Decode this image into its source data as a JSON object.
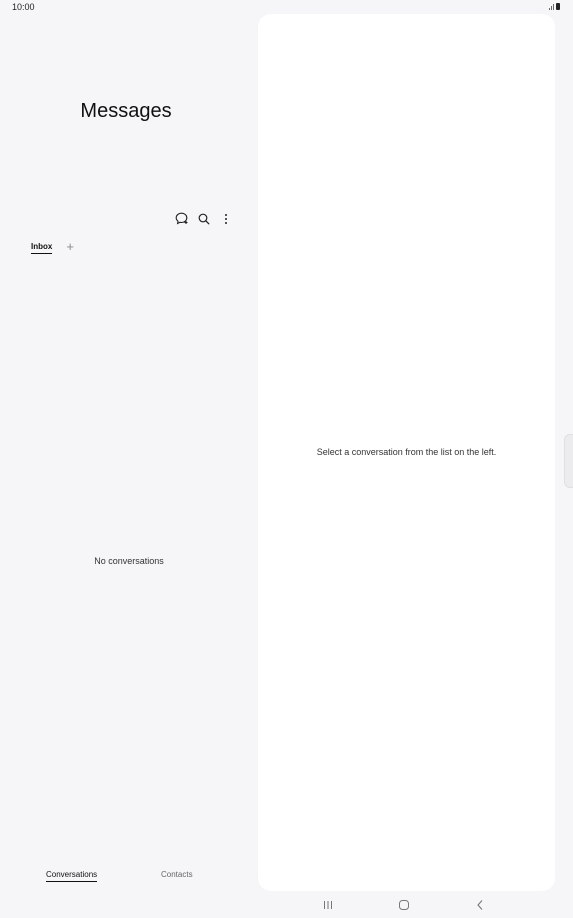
{
  "status_bar": {
    "time": "10:00"
  },
  "left_pane": {
    "title": "Messages",
    "toolbar": {
      "icons": [
        "new-message-icon",
        "search-icon",
        "more-options-icon"
      ]
    },
    "tabs": [
      {
        "label": "Inbox",
        "selected": true
      }
    ],
    "add_tab_label": "+",
    "empty_state": "No conversations",
    "bottom_tabs": [
      {
        "label": "Conversations",
        "selected": true
      },
      {
        "label": "Contacts",
        "selected": false
      }
    ]
  },
  "right_pane": {
    "hint": "Select a conversation from the list on the left."
  },
  "nav_bar": {
    "icons": [
      "recents-icon",
      "home-icon",
      "back-icon"
    ]
  },
  "colors": {
    "background": "#f6f6f8",
    "panel": "#ffffff",
    "text": "#111111"
  }
}
